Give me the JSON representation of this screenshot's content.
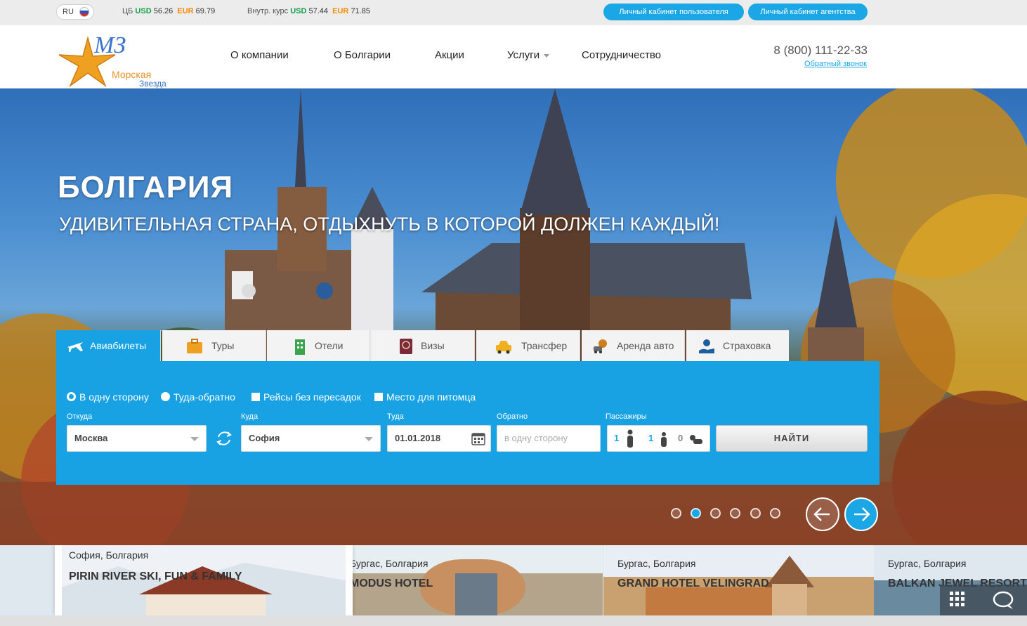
{
  "topbar": {
    "lang": "RU",
    "cb_label": "ЦБ",
    "cb_usd_label": "USD",
    "cb_usd": "56.26",
    "cb_eur_label": "EUR",
    "cb_eur": "69.79",
    "internal_label": "Внутр. курс",
    "int_usd_label": "USD",
    "int_usd": "57.44",
    "int_eur_label": "EUR",
    "int_eur": "71.85",
    "user_cabinet": "Личный кабинет пользователя",
    "agency_cabinet": "Личный кабинет агентства"
  },
  "header": {
    "logo_mark": "МЗ",
    "logo_line1": "Морская",
    "logo_line2": "Звезда",
    "nav": [
      "О компании",
      "О Болгарии",
      "Акции",
      "Услуги",
      "Сотрудничество"
    ],
    "phone": "8 (800) 111-22-33",
    "callback": "Обратный звонок"
  },
  "hero": {
    "title": "БОЛГАРИЯ",
    "subtitle": "УДИВИТЕЛЬНАЯ СТРАНА, ОТДЫХНУТЬ В КОТОРОЙ ДОЛЖЕН КАЖДЫЙ!"
  },
  "search": {
    "tabs": [
      "Авиабилеты",
      "Туры",
      "Отели",
      "Визы",
      "Трансфер",
      "Аренда авто",
      "Страховка"
    ],
    "active_tab": "Авиабилеты",
    "options": {
      "one_way": "В одну сторону",
      "round_trip": "Туда-обратно",
      "direct": "Рейсы без пересадок",
      "pet": "Место для питомца"
    },
    "labels": {
      "from": "Откуда",
      "to": "Куда",
      "depart": "Туда",
      "return": "Обратно",
      "passengers": "Пассажиры"
    },
    "from_value": "Москва",
    "to_value": "София",
    "depart_value": "01.01.2018",
    "return_placeholder": "в одну сторону",
    "adults": "1",
    "children": "1",
    "infants": "0",
    "find_button": "НАЙТИ"
  },
  "slider": {
    "total_slides": 6,
    "active_slide": 2
  },
  "cards": [
    {
      "city": "София, Болгария",
      "hotel": "PIRIN RIVER SKI, FUN & FAMILY"
    },
    {
      "city": "Бургас, Болгария",
      "hotel": "MODUS HOTEL"
    },
    {
      "city": "Бургас, Болгария",
      "hotel": "GRAND HOTEL VELINGRAD"
    },
    {
      "city": "Бургас, Болгария",
      "hotel": "BALKAN JEWEL RESORT &"
    }
  ],
  "colors": {
    "accent": "#19a2e3",
    "usd": "#12a04a",
    "eur": "#f08a00"
  }
}
